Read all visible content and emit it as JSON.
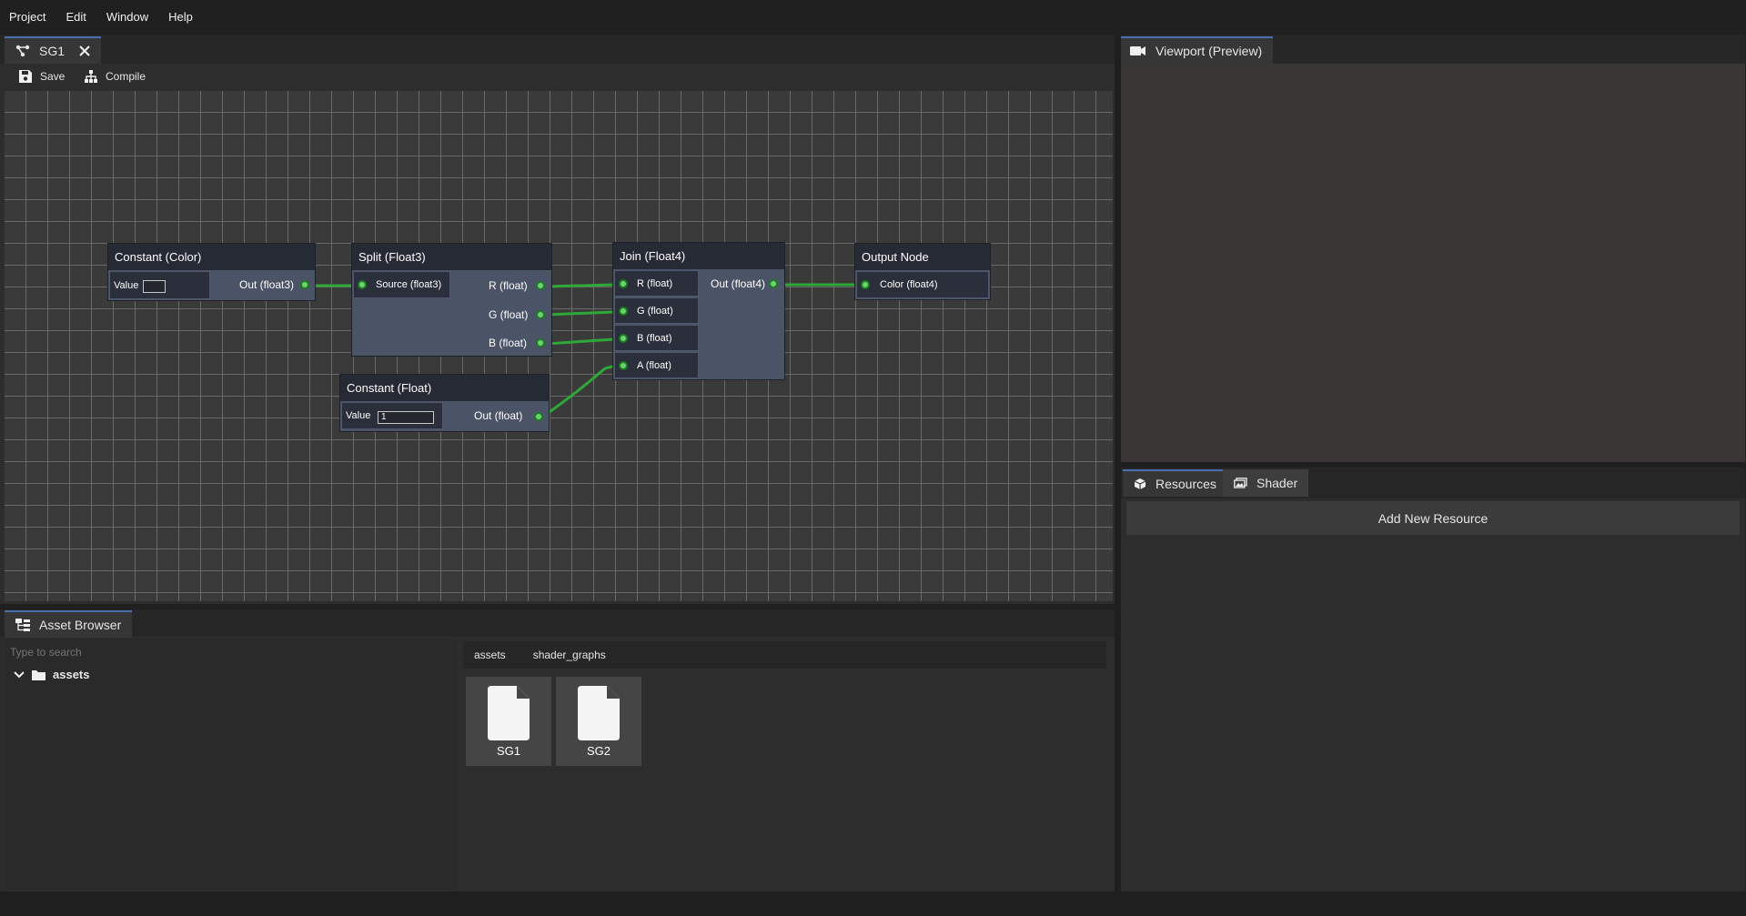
{
  "menubar": {
    "items": [
      "Project",
      "Edit",
      "Window",
      "Help"
    ]
  },
  "graph_panel": {
    "tab_title": "SG1",
    "toolbar": {
      "save_label": "Save",
      "compile_label": "Compile"
    },
    "nodes": {
      "constant_color": {
        "title": "Constant (Color)",
        "value_label": "Value",
        "output": "Out (float3)"
      },
      "split": {
        "title": "Split (Float3)",
        "input": "Source (float3)",
        "outputs": [
          "R (float)",
          "G (float)",
          "B (float)"
        ]
      },
      "join": {
        "title": "Join (Float4)",
        "inputs": [
          "R (float)",
          "G (float)",
          "B (float)",
          "A (float)"
        ],
        "output": "Out (float4)"
      },
      "output": {
        "title": "Output Node",
        "input": "Color (float4)"
      },
      "constant_float": {
        "title": "Constant (Float)",
        "value_label": "Value",
        "value": "1",
        "output": "Out (float)"
      }
    },
    "wire_color": "#2ea836"
  },
  "viewport": {
    "title": "Viewport (Preview)"
  },
  "resources": {
    "tabs": [
      "Resources",
      "Shader"
    ],
    "add_button": "Add New Resource"
  },
  "asset_browser": {
    "title": "Asset Browser",
    "search_placeholder": "Type to search",
    "tree": {
      "root": "assets"
    },
    "breadcrumb": [
      "assets",
      "shader_graphs"
    ],
    "files": [
      "SG1",
      "SG2"
    ]
  },
  "colors": {
    "accent": "#4a6fb0",
    "port": "#6ad46f",
    "node_body": "#4b5367",
    "node_header": "#262a35"
  }
}
